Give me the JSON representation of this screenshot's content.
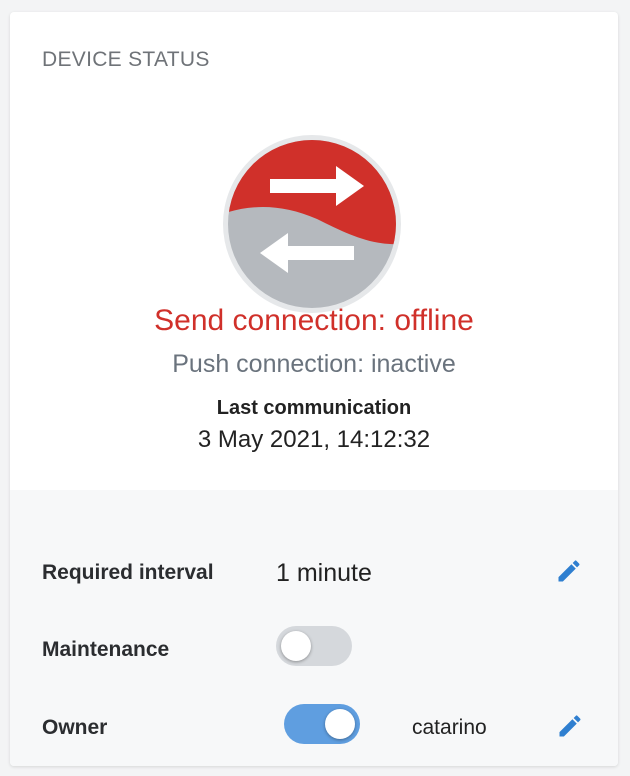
{
  "card": {
    "title": "DEVICE STATUS"
  },
  "status": {
    "send_connection": "Send connection: offline",
    "push_connection": "Push connection: inactive",
    "last_communication_label": "Last communication",
    "last_communication_value": "3 May 2021, 14:12:32",
    "icon": "send-push-arrows-icon",
    "colors": {
      "offline": "#d0302a",
      "inactive": "#b5b9be"
    }
  },
  "settings": {
    "required_interval": {
      "label": "Required interval",
      "value": "1 minute",
      "edit_icon": "pencil-icon"
    },
    "maintenance": {
      "label": "Maintenance",
      "enabled": false
    },
    "owner": {
      "label": "Owner",
      "enabled": true,
      "value": "catarino",
      "edit_icon": "pencil-icon"
    }
  },
  "colors": {
    "accent": "#2f7fd0",
    "toggle_on": "#5f9ee0",
    "toggle_off": "#d5d8dc"
  }
}
